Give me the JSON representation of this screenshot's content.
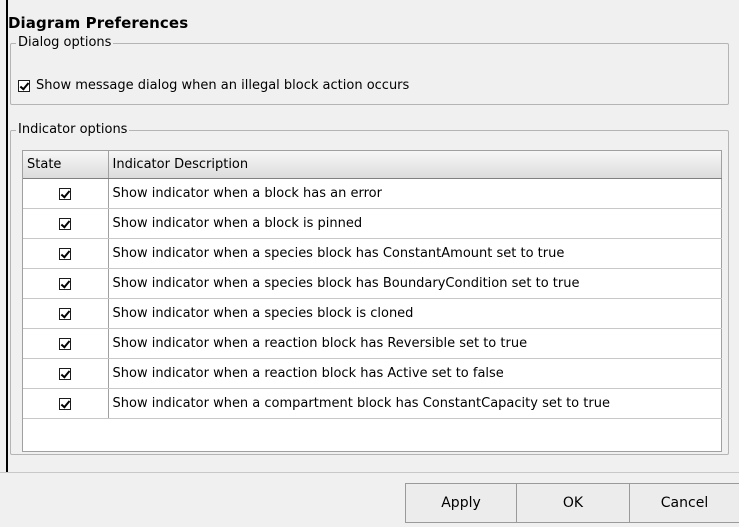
{
  "window": {
    "title": "Diagram Preferences"
  },
  "dialog_options": {
    "legend": "Dialog options",
    "show_message_dialog": {
      "label": "Show message dialog when an illegal block action occurs",
      "checked": true
    }
  },
  "indicator_options": {
    "legend": "Indicator options",
    "columns": [
      "State",
      "Indicator Description"
    ],
    "rows": [
      {
        "checked": true,
        "description": "Show indicator when a block has an error"
      },
      {
        "checked": true,
        "description": "Show indicator when a block is pinned"
      },
      {
        "checked": true,
        "description": "Show indicator when a species block has ConstantAmount set to true"
      },
      {
        "checked": true,
        "description": "Show indicator when a species block has BoundaryCondition set to true"
      },
      {
        "checked": true,
        "description": "Show indicator when a species block is cloned"
      },
      {
        "checked": true,
        "description": "Show indicator when a reaction block has Reversible set to true"
      },
      {
        "checked": true,
        "description": "Show indicator when a reaction block has Active set to false"
      },
      {
        "checked": true,
        "description": "Show indicator when a compartment block has ConstantCapacity set to true"
      }
    ]
  },
  "buttons": {
    "apply": "Apply",
    "ok": "OK",
    "cancel": "Cancel"
  }
}
